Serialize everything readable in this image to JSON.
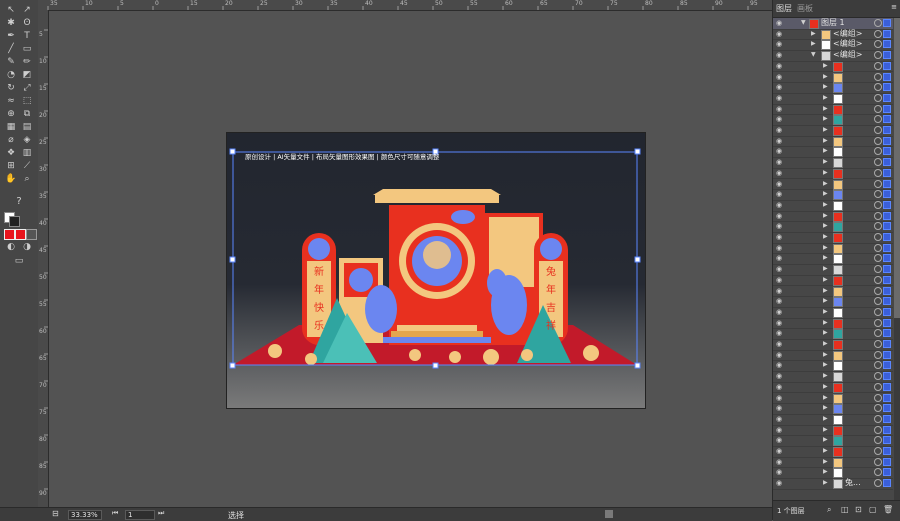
{
  "toolbar": {
    "tools": [
      "selection-tool",
      "direct-selection-tool",
      "magic-wand-tool",
      "lasso-tool",
      "pen-tool",
      "type-tool",
      "line-tool",
      "rectangle-tool",
      "paintbrush-tool",
      "pencil-tool",
      "blob-brush-tool",
      "eraser-tool",
      "rotate-tool",
      "scale-tool",
      "warp-tool",
      "free-transform-tool",
      "shape-builder-tool",
      "perspective-tool",
      "mesh-tool",
      "gradient-tool",
      "eyedropper-tool",
      "blend-tool",
      "symbol-sprayer-tool",
      "column-graph-tool",
      "artboard-tool",
      "slice-tool",
      "hand-tool",
      "zoom-tool"
    ],
    "question_glyph": "?",
    "fill_color": "#e8141d",
    "stroke_color": "#e8141d"
  },
  "ruler": {
    "top_labels": [
      "35",
      "10",
      "5",
      "0",
      "15",
      "20",
      "25",
      "30",
      "35",
      "40",
      "45",
      "50",
      "55",
      "60",
      "65",
      "70",
      "75",
      "80",
      "85",
      "90",
      "95"
    ],
    "left_labels": [
      "5",
      "10",
      "15",
      "20",
      "25",
      "30",
      "35",
      "40",
      "45",
      "50",
      "55",
      "60",
      "65",
      "70",
      "75",
      "80",
      "85",
      "90"
    ]
  },
  "artboard": {
    "caption": "原创设计 | AI矢量文件 | 布局矢量图形效果图 | 颜色尺寸可随意调整",
    "left_banner": [
      "新",
      "年",
      "快",
      "乐"
    ],
    "right_banner": [
      "兔",
      "年",
      "吉",
      "祥"
    ],
    "colors": {
      "red": "#e8301f",
      "cream": "#f3c77f",
      "selection": "#5a86ff",
      "floor": "#c21a2a"
    }
  },
  "panel": {
    "tabs": [
      "图层",
      "画板"
    ],
    "layer_name": "图层 1",
    "groups": [
      "<编组>",
      "<编组>",
      "<编组>"
    ],
    "bottom_row_label": "兔...",
    "footer_count": "1 个图层"
  },
  "status": {
    "zoom": "33.33%",
    "artboard_number": "1",
    "tool_name": "选择"
  }
}
